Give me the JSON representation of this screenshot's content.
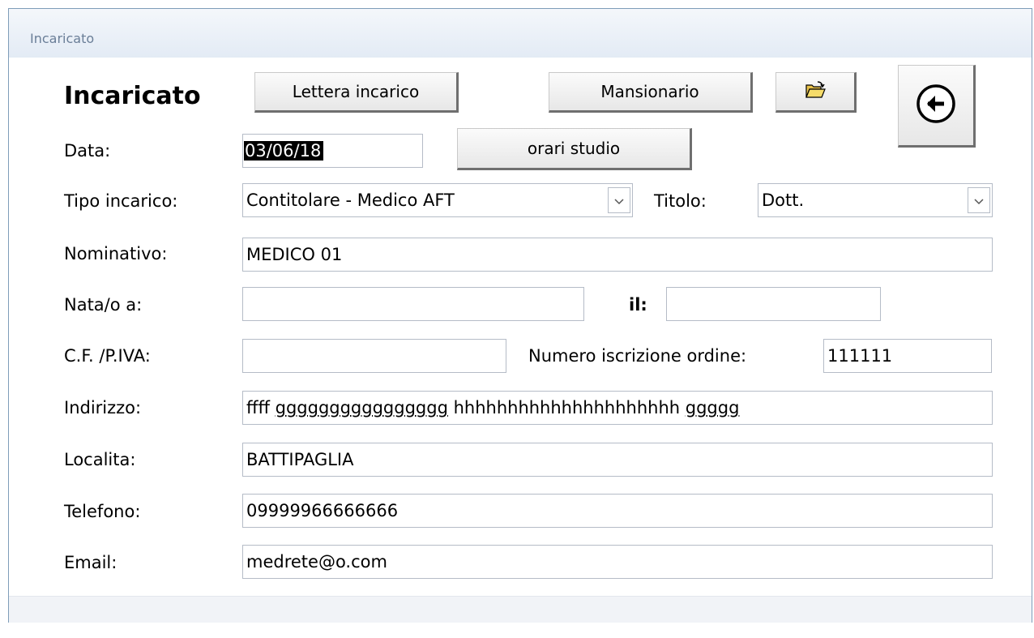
{
  "window": {
    "title": "Incaricato"
  },
  "form": {
    "heading": "Incaricato",
    "buttons": {
      "lettera": "Lettera incarico",
      "mansionario": "Mansionario",
      "orari": "orari studio"
    },
    "labels": {
      "data": "Data:",
      "tipo": "Tipo incarico:",
      "titolo": "Titolo:",
      "nominativo": "Nominativo:",
      "nata": "Nata/o a:",
      "il": "il:",
      "cf": "C.F. /P.IVA:",
      "numero": "Numero iscrizione ordine:",
      "indirizzo": "Indirizzo:",
      "localita": "Localita:",
      "telefono": "Telefono:",
      "email": "Email:"
    },
    "values": {
      "data": "03/06/18",
      "tipo": "Contitolare - Medico AFT",
      "titolo": "Dott.",
      "nominativo": "MEDICO 01",
      "nata": "",
      "il": "",
      "cf": "",
      "numero": "111111",
      "indirizzo_part1": "ffff ",
      "indirizzo_part2": "gggggggggggggggg",
      "indirizzo_part3": " hhhhhhhhhhhhhhhhhhhhh ",
      "indirizzo_part4": "ggggg",
      "localita": "BATTIPAGLIA",
      "telefono": "09999966666666",
      "email": "medrete@o.com"
    }
  },
  "icons": {
    "folder": "open-folder-icon",
    "back": "back-arrow-icon",
    "combo": "chevron-down-icon"
  }
}
